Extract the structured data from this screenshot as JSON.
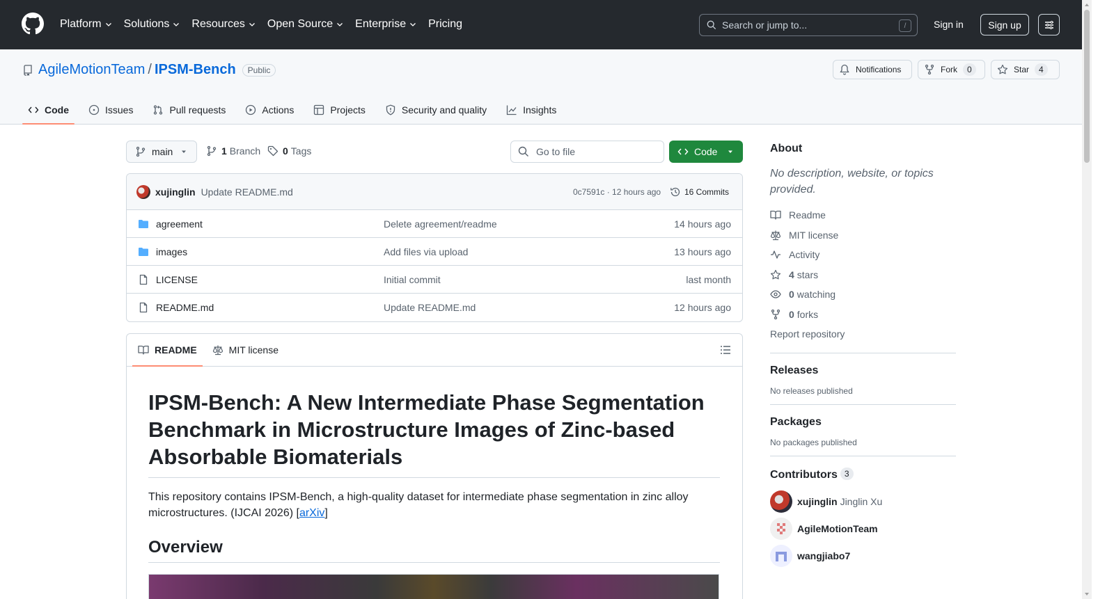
{
  "header": {
    "nav": [
      "Platform",
      "Solutions",
      "Resources",
      "Open Source",
      "Enterprise",
      "Pricing"
    ],
    "search_placeholder": "Search or jump to...",
    "search_shortcut": "/",
    "sign_in": "Sign in",
    "sign_up": "Sign up"
  },
  "repo": {
    "owner": "AgileMotionTeam",
    "separator": "/",
    "name": "IPSM-Bench",
    "visibility": "Public",
    "notifications_label": "Notifications",
    "fork_label": "Fork",
    "fork_count": "0",
    "star_label": "Star",
    "star_count": "4",
    "tabs": [
      "Code",
      "Issues",
      "Pull requests",
      "Actions",
      "Projects",
      "Security and quality",
      "Insights"
    ]
  },
  "code": {
    "branch": "main",
    "branch_count": "1",
    "branch_label": "Branch",
    "tag_count": "0",
    "tag_label": "Tags",
    "go_to_file": "Go to file",
    "code_button": "Code",
    "latest_commit": {
      "author": "xujinglin",
      "message": "Update README.md",
      "meta": "0c7591c · 12 hours ago",
      "commits": "16 Commits"
    },
    "files": [
      {
        "type": "dir",
        "name": "agreement",
        "message": "Delete agreement/readme",
        "age": "14 hours ago"
      },
      {
        "type": "dir",
        "name": "images",
        "message": "Add files via upload",
        "age": "13 hours ago"
      },
      {
        "type": "file",
        "name": "LICENSE",
        "message": "Initial commit",
        "age": "last month"
      },
      {
        "type": "file",
        "name": "README.md",
        "message": "Update README.md",
        "age": "12 hours ago"
      }
    ]
  },
  "readme": {
    "tabs": [
      "README",
      "MIT license"
    ],
    "title": "IPSM-Bench: A New Intermediate Phase Segmentation Benchmark in Microstructure Images of Zinc-based Absorbable Biomaterials",
    "intro": "This repository contains IPSM-Bench, a high-quality dataset for intermediate phase segmentation in zinc alloy microstructures. (IJCAI 2026) ",
    "intro_bracket_open": "[",
    "intro_link": "arXiv",
    "intro_bracket_close": "]",
    "overview_heading": "Overview"
  },
  "sidebar": {
    "about_heading": "About",
    "about_desc": "No description, website, or topics provided.",
    "items": {
      "readme": "Readme",
      "license": "MIT license",
      "activity": "Activity",
      "stars_count": "4",
      "stars_label": "stars",
      "watching_count": "0",
      "watching_label": "watching",
      "forks_count": "0",
      "forks_label": "forks",
      "report": "Report repository"
    },
    "releases_heading": "Releases",
    "releases_text": "No releases published",
    "packages_heading": "Packages",
    "packages_text": "No packages published",
    "contributors_heading": "Contributors",
    "contributors_count": "3",
    "contributors": [
      {
        "login": "xujinglin",
        "name": "Jinglin Xu"
      },
      {
        "login": "AgileMotionTeam",
        "name": ""
      },
      {
        "login": "wangjiabo7",
        "name": ""
      }
    ]
  },
  "colors": {
    "header_bg": "#25292e",
    "link": "#0969da",
    "primary_button": "#1f883d",
    "active_tab_underline": "#fd8c73",
    "folder_icon": "#54aeff"
  }
}
